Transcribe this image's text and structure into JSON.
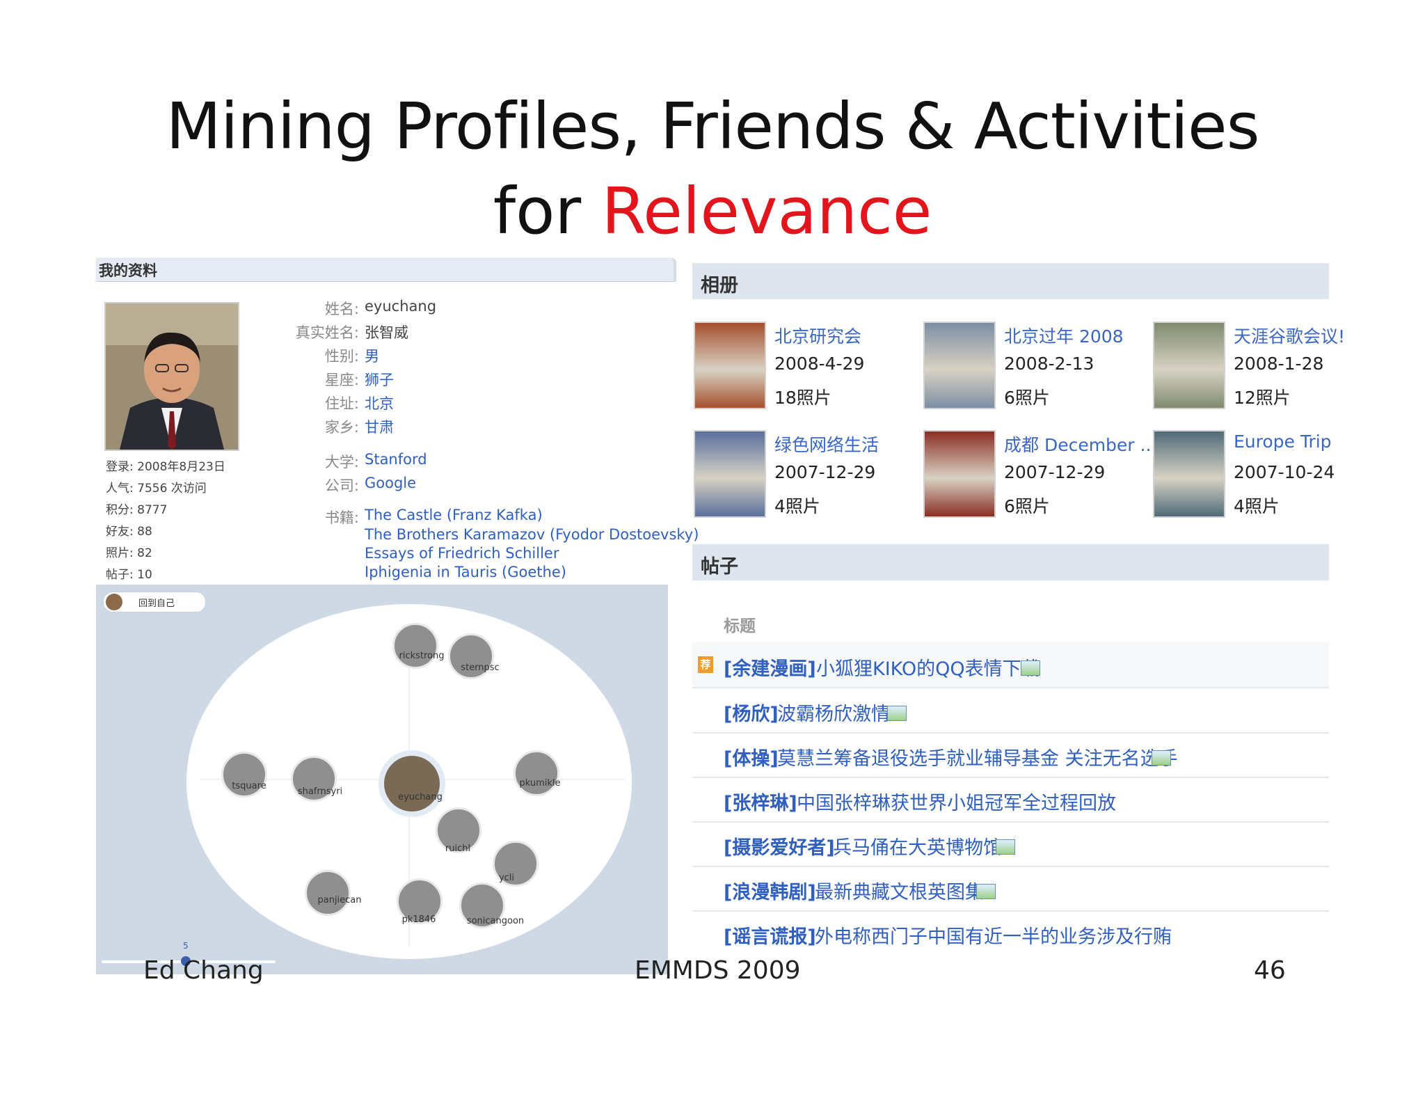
{
  "slide": {
    "title_line1": "Mining Profiles, Friends & Activities",
    "title_prefix": "for ",
    "title_accent": "Relevance",
    "accent_color": "#e3141b",
    "footer_left": "Ed Chang",
    "footer_center": "EMMDS 2009",
    "page_number": "46"
  },
  "profile": {
    "header": "我的资料",
    "stats": [
      "登录: 2008年8月23日",
      "人气: 7556 次访问",
      "积分: 8777",
      "好友: 88",
      "照片: 82",
      "帖子: 10"
    ],
    "fields": [
      {
        "label": "姓名:",
        "value": "eyuchang"
      },
      {
        "label": "真实姓名:",
        "value": "张智威"
      },
      {
        "label": "性别:",
        "value": "男"
      },
      {
        "label": "星座:",
        "value": "狮子"
      },
      {
        "label": "住址:",
        "value": "北京"
      },
      {
        "label": "家乡:",
        "value": "甘肃"
      },
      {
        "label": "大学:",
        "value": "Stanford"
      },
      {
        "label": "公司:",
        "value": "Google"
      }
    ],
    "books_label": "书籍:",
    "books": [
      "The Castle (Franz Kafka)",
      "The Brothers Karamazov (Fyodor Dostoevsky)",
      "Essays of Friedrich Schiller",
      "Iphigenia in Tauris (Goethe)"
    ]
  },
  "network": {
    "back_button": "回到自己",
    "center_name": "eyuchang",
    "friends": [
      "rickstrong",
      "sternpsc",
      "tsquare",
      "shafrnsyri",
      "pkumikle",
      "ruichl",
      "ycli",
      "panjiecan",
      "pk1846",
      "sonicangoon"
    ],
    "slider_value": "5"
  },
  "albums": {
    "header": "相册",
    "items": [
      {
        "title": "北京研究会",
        "date": "2008-4-29",
        "count": "18照片",
        "color": "#a5502e"
      },
      {
        "title": "北京过年 2008",
        "date": "2008-2-13",
        "count": "6照片",
        "color": "#7d8ea3"
      },
      {
        "title": "天涯谷歌会议!",
        "date": "2008-1-28",
        "count": "12照片",
        "color": "#7f8a6f"
      },
      {
        "title": "绿色网络生活",
        "date": "2007-12-29",
        "count": "4照片",
        "color": "#5a6f9a"
      },
      {
        "title": "成都 December ...",
        "date": "2007-12-29",
        "count": "6照片",
        "color": "#8a2e24"
      },
      {
        "title": "Europe Trip",
        "date": "2007-10-24",
        "count": "4照片",
        "color": "#4f6a78"
      }
    ]
  },
  "posts": {
    "header": "帖子",
    "column_label": "标题",
    "hot_badge": "荐",
    "items": [
      {
        "category": "[余建漫画]",
        "title": "小狐狸KIKO的QQ表情下载",
        "has_image": true
      },
      {
        "category": "[杨欣]",
        "title": "波霸杨欣激情",
        "has_image": true
      },
      {
        "category": "[体操]",
        "title": "莫慧兰筹备退役选手就业辅导基金 关注无名选手",
        "has_image": true
      },
      {
        "category": "[张梓琳]",
        "title": "中国张梓琳获世界小姐冠军全过程回放",
        "has_image": false
      },
      {
        "category": "[摄影爱好者]",
        "title": "兵马俑在大英博物馆",
        "has_image": true
      },
      {
        "category": "[浪漫韩剧]",
        "title": "最新典藏文根英图集",
        "has_image": true
      },
      {
        "category": "[谣言谎报]",
        "title": "外电称西门子中国有近一半的业务涉及行贿",
        "has_image": false
      }
    ]
  }
}
